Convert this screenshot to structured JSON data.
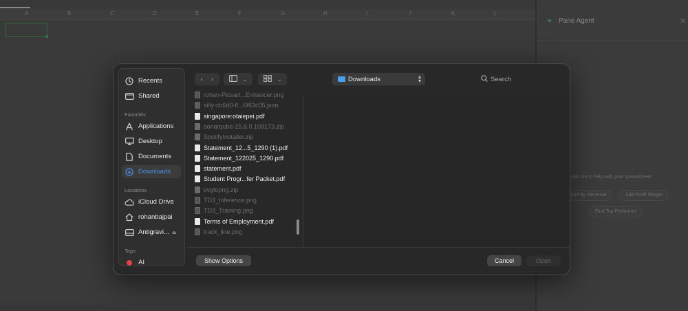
{
  "background": {
    "column_letters": [
      "A",
      "B",
      "C",
      "D",
      "E",
      "F",
      "G",
      "H",
      "I",
      "J",
      "K",
      "L"
    ],
    "pane": {
      "title": "Pane Agent",
      "hint": "Ask me to help with your spreadsheet",
      "chips": [
        "Sort by Revenue",
        "Add Profit Margin",
        "Find Top Performer"
      ]
    }
  },
  "sidebar": {
    "top_items": [
      {
        "label": "Recents",
        "icon": "clock-icon"
      },
      {
        "label": "Shared",
        "icon": "shared-folder-icon"
      }
    ],
    "favorites_header": "Favorites",
    "favorites": [
      {
        "label": "Applications",
        "icon": "applications-icon"
      },
      {
        "label": "Desktop",
        "icon": "desktop-icon"
      },
      {
        "label": "Documents",
        "icon": "document-icon"
      },
      {
        "label": "Downloads",
        "icon": "download-icon",
        "active": true
      }
    ],
    "locations_header": "Locations",
    "locations": [
      {
        "label": "iCloud Drive",
        "icon": "cloud-icon"
      },
      {
        "label": "rohanbajpai",
        "icon": "home-icon"
      },
      {
        "label": "Antigravi...",
        "icon": "drive-icon"
      }
    ],
    "tags_header": "Tags",
    "tags": [
      {
        "label": "AI",
        "color": "#e0424c"
      }
    ]
  },
  "toolbar": {
    "back": "‹",
    "forward": "›",
    "path_label": "Downloads",
    "search_placeholder": "Search"
  },
  "files": [
    {
      "name": "rohan-Picsart...Enhancer.png",
      "dim": true,
      "kind": "img"
    },
    {
      "name": "silly-cb6d0-fl...6f63c05.json",
      "dim": true,
      "kind": "doc"
    },
    {
      "name": "singapore:otaiepei.pdf",
      "dim": false,
      "kind": "doc"
    },
    {
      "name": "sonarqube-25.6.0.109173.zip",
      "dim": true,
      "kind": "zip"
    },
    {
      "name": "SpotifyInstaller.zip",
      "dim": true,
      "kind": "zip"
    },
    {
      "name": "Statement_12...5_1290 (1).pdf",
      "dim": false,
      "kind": "doc"
    },
    {
      "name": "Statement_122025_1290.pdf",
      "dim": false,
      "kind": "doc"
    },
    {
      "name": "statement.pdf",
      "dim": false,
      "kind": "doc"
    },
    {
      "name": "Student Progr...fer Packet.pdf",
      "dim": false,
      "kind": "doc"
    },
    {
      "name": "svgtopng.zip",
      "dim": true,
      "kind": "zip"
    },
    {
      "name": "TD3_Inference.png",
      "dim": true,
      "kind": "img"
    },
    {
      "name": "TD3_Training.png",
      "dim": true,
      "kind": "img"
    },
    {
      "name": "Terms of Employment.pdf",
      "dim": false,
      "kind": "doc"
    },
    {
      "name": "track_line.png",
      "dim": true,
      "kind": "img"
    }
  ],
  "buttons": {
    "show_options": "Show Options",
    "cancel": "Cancel",
    "open": "Open"
  }
}
